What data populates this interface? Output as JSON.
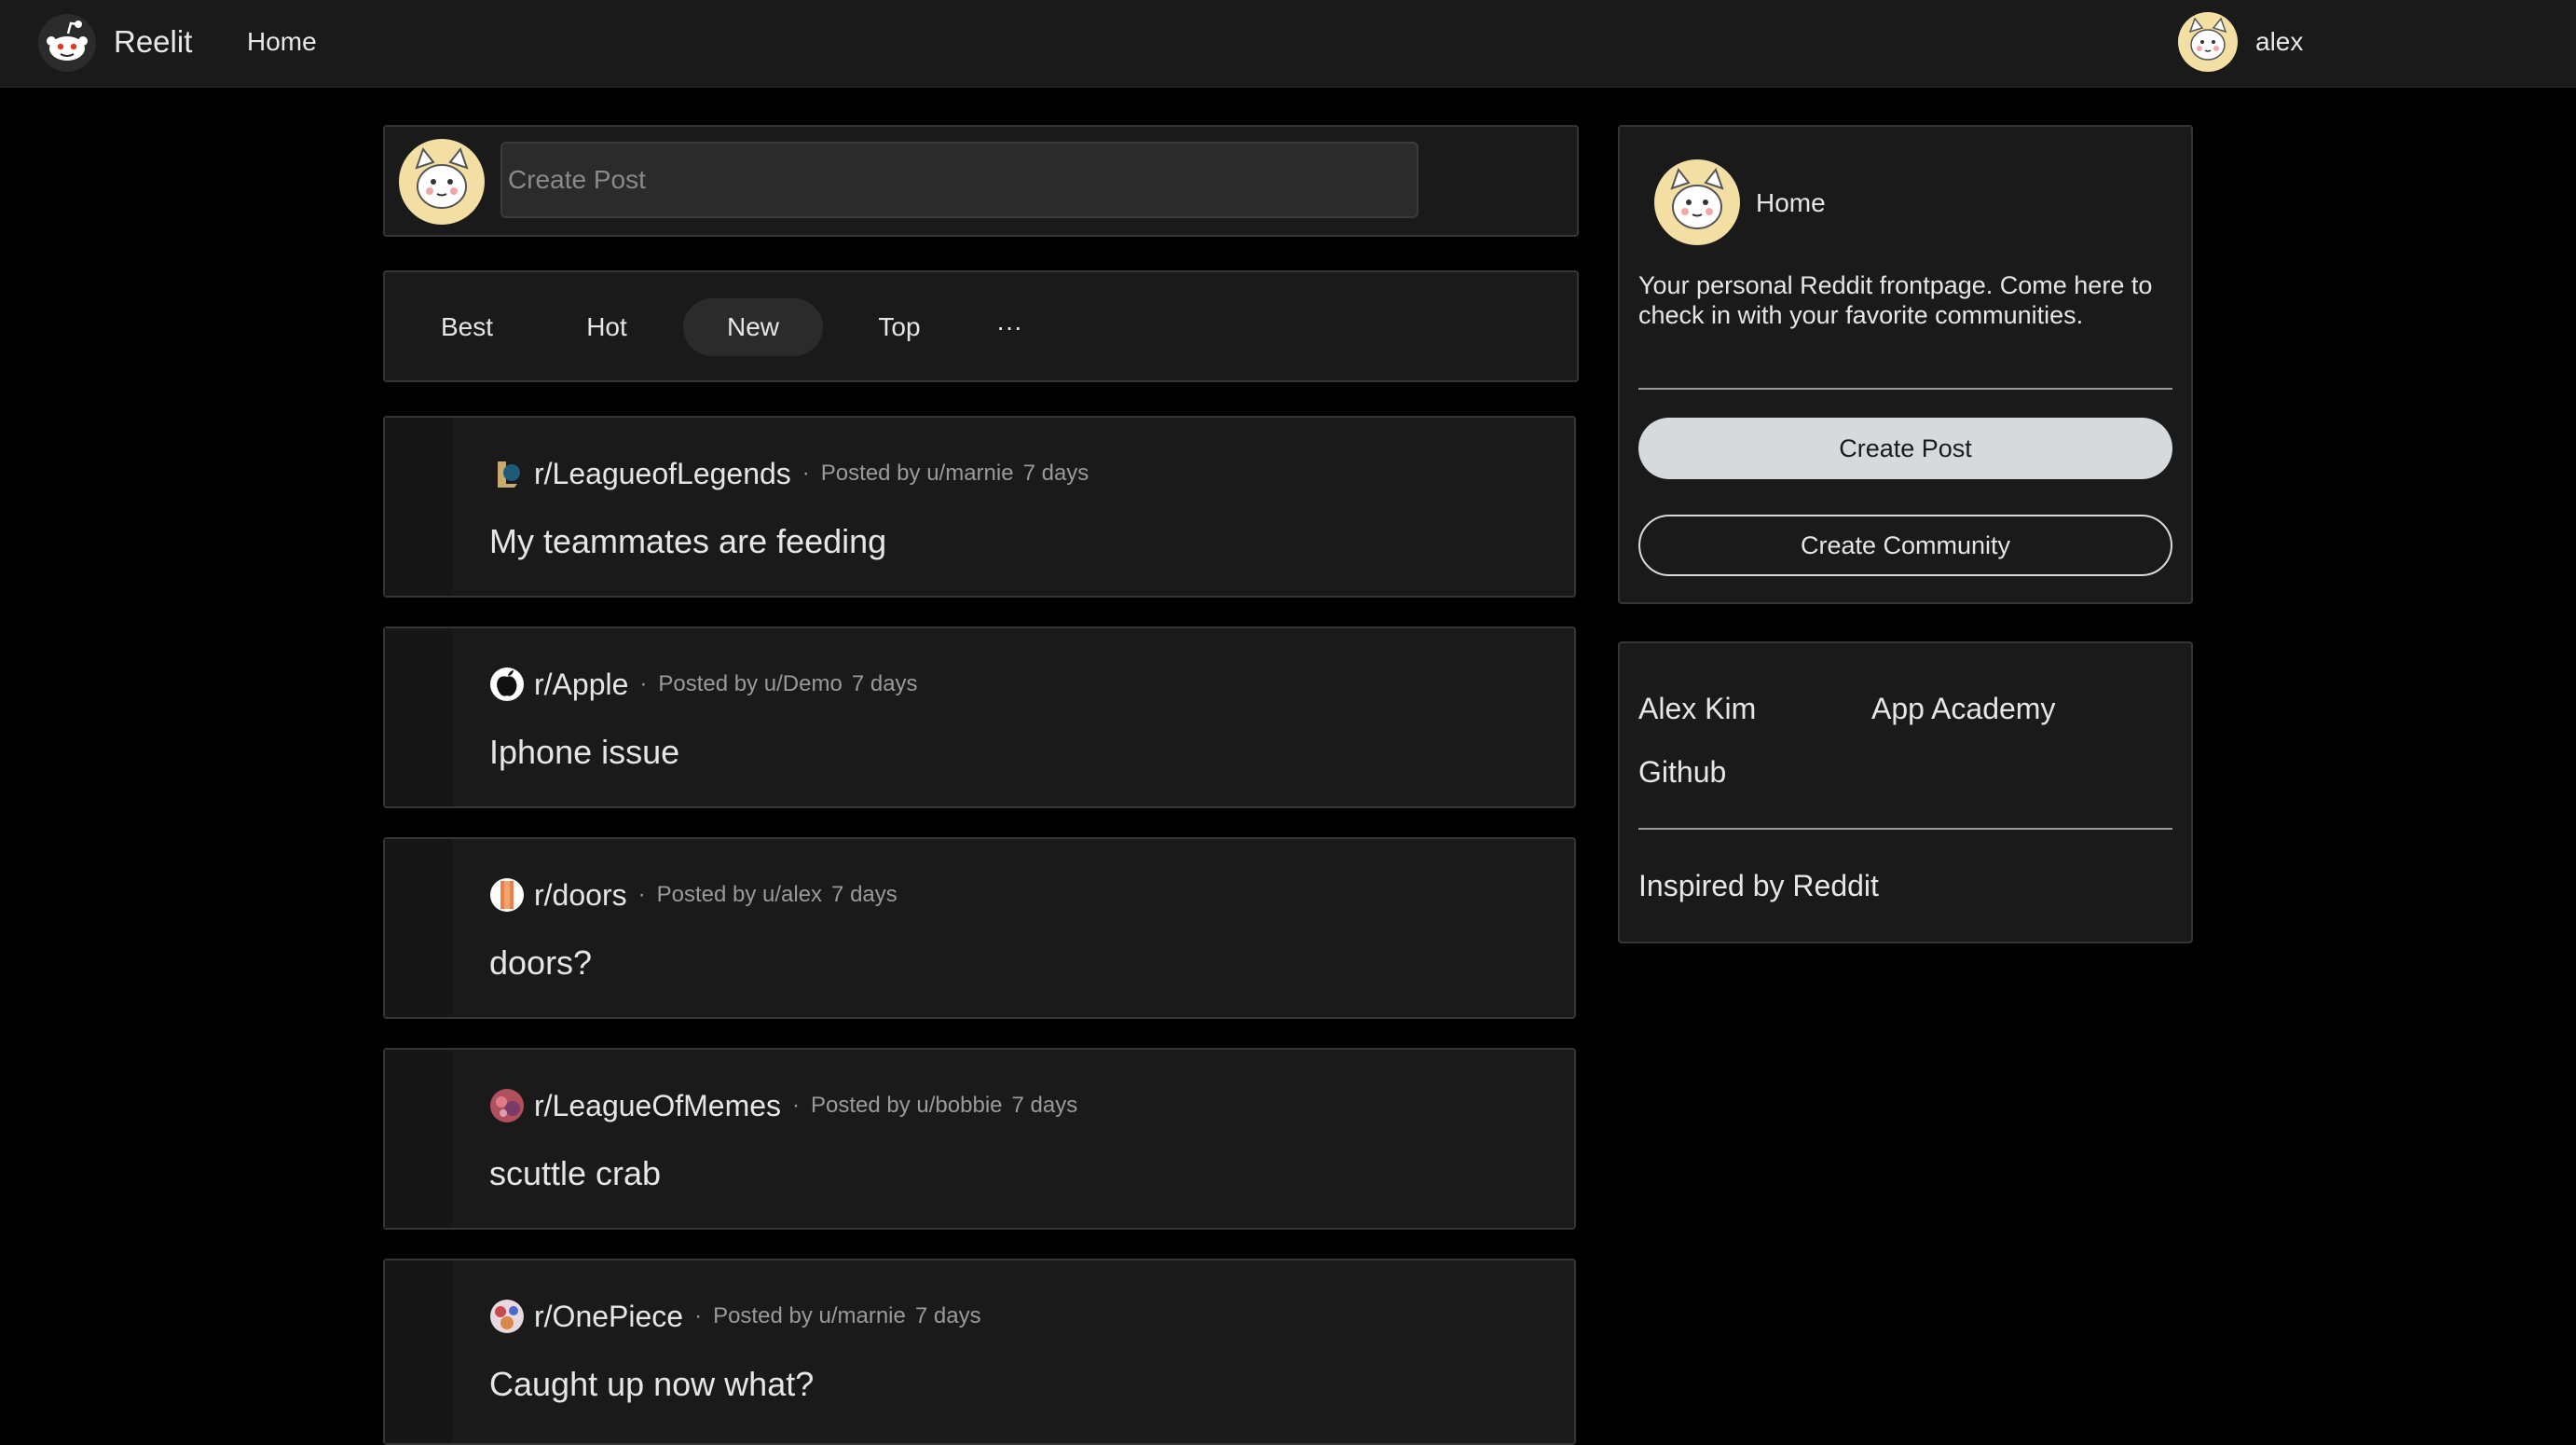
{
  "header": {
    "brand": "Reelit",
    "nav_home": "Home",
    "username": "alex"
  },
  "create_post": {
    "placeholder": "Create Post"
  },
  "sort_tabs": [
    {
      "label": "Best",
      "active": false
    },
    {
      "label": "Hot",
      "active": false
    },
    {
      "label": "New",
      "active": true
    },
    {
      "label": "Top",
      "active": false
    },
    {
      "label": "···",
      "active": false
    }
  ],
  "posts": [
    {
      "community": "r/LeagueofLegends",
      "posted_by": "Posted by u/marnie",
      "age": "7 days",
      "title": "My teammates are feeding",
      "icon": "league-of-legends-icon"
    },
    {
      "community": "r/Apple",
      "posted_by": "Posted by u/Demo",
      "age": "7 days",
      "title": "Iphone issue",
      "icon": "apple-icon"
    },
    {
      "community": "r/doors",
      "posted_by": "Posted by u/alex",
      "age": "7 days",
      "title": "doors?",
      "icon": "doors-icon"
    },
    {
      "community": "r/LeagueOfMemes",
      "posted_by": "Posted by u/bobbie",
      "age": "7 days",
      "title": "scuttle crab",
      "icon": "league-of-memes-icon"
    },
    {
      "community": "r/OnePiece",
      "posted_by": "Posted by u/marnie",
      "age": "7 days",
      "title": "Caught up now what?",
      "icon": "one-piece-icon"
    }
  ],
  "sidebar": {
    "title": "Home",
    "description": "Your personal Reddit frontpage. Come here to check in with your favorite communities.",
    "create_post_label": "Create Post",
    "create_community_label": "Create Community"
  },
  "links": {
    "alex_kim": "Alex Kim",
    "app_academy": "App Academy",
    "github": "Github",
    "inspired": "Inspired by Reddit"
  },
  "colors": {
    "background": "#000000",
    "panel": "#1a1a1b",
    "border": "#343536",
    "muted_text": "#9a9a9a"
  }
}
